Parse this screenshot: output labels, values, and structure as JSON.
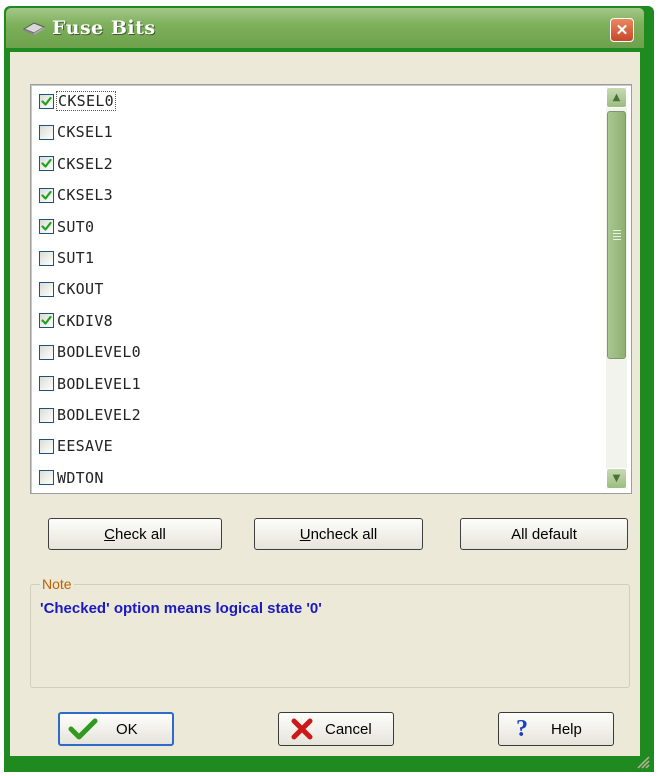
{
  "window": {
    "title": "Fuse Bits",
    "icon": "chip-icon",
    "close_icon": "close-icon"
  },
  "fuse_list": {
    "items": [
      {
        "label": "CKSEL0",
        "checked": true
      },
      {
        "label": "CKSEL1",
        "checked": false
      },
      {
        "label": "CKSEL2",
        "checked": true
      },
      {
        "label": "CKSEL3",
        "checked": true
      },
      {
        "label": "SUT0",
        "checked": true
      },
      {
        "label": "SUT1",
        "checked": false
      },
      {
        "label": "CKOUT",
        "checked": false
      },
      {
        "label": "CKDIV8",
        "checked": true
      },
      {
        "label": "BODLEVEL0",
        "checked": false
      },
      {
        "label": "BODLEVEL1",
        "checked": false
      },
      {
        "label": "BODLEVEL2",
        "checked": false
      },
      {
        "label": "EESAVE",
        "checked": false
      },
      {
        "label": "WDTON",
        "checked": false
      }
    ]
  },
  "actions": {
    "check_all": {
      "mnemonic": "C",
      "rest": "heck all"
    },
    "uncheck_all": {
      "mnemonic": "U",
      "rest": "ncheck all"
    },
    "all_default": "All default"
  },
  "note": {
    "legend": "Note",
    "text": "'Checked' option means logical state '0'"
  },
  "buttons": {
    "ok": "OK",
    "cancel": "Cancel",
    "help": "Help"
  },
  "colors": {
    "title_green": "#6ea14b",
    "note_text": "#1a1ac0",
    "legend": "#c06000"
  }
}
